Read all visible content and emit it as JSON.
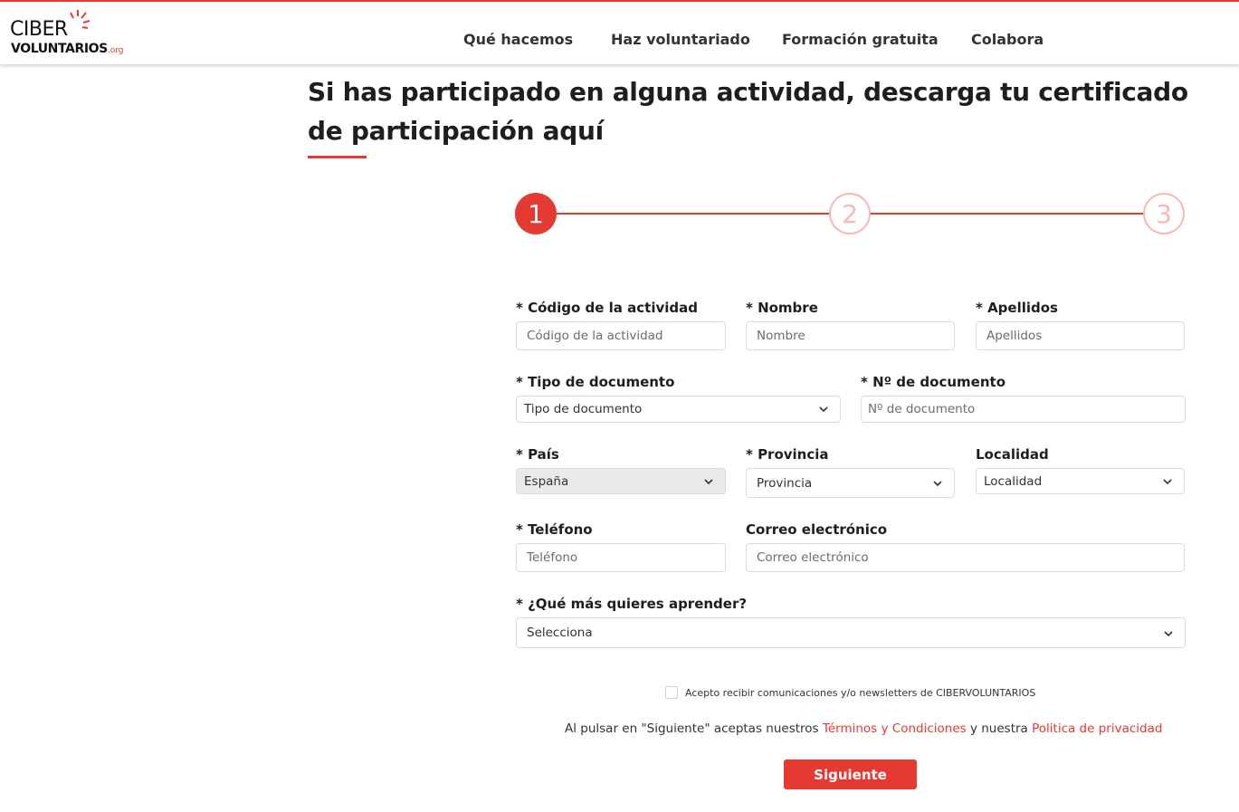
{
  "header": {
    "logo_top": "CIBER",
    "logo_bottom": "VOLUNTARIOS",
    "logo_org": ".org",
    "nav": [
      "Qué hacemos",
      "Haz voluntariado",
      "Formación gratuita",
      "Colabora"
    ]
  },
  "page": {
    "headline": "Si has participado en alguna actividad, descarga tu certificado de participación aquí"
  },
  "stepper": {
    "steps": [
      "1",
      "2",
      "3"
    ],
    "current_step": 1
  },
  "form": {
    "codigo": {
      "label": "* Código de la actividad",
      "placeholder": "Código de la actividad"
    },
    "nombre": {
      "label": "* Nombre",
      "placeholder": "Nombre"
    },
    "apellidos": {
      "label": "* Apellidos",
      "placeholder": "Apellidos"
    },
    "tipo_doc": {
      "label": "* Tipo de documento",
      "value": "Tipo de documento"
    },
    "num_doc": {
      "label": "* Nº de documento",
      "placeholder": "Nº de documento"
    },
    "pais": {
      "label": "* País",
      "value": "España"
    },
    "provincia": {
      "label": "* Provincia",
      "value": "Provincia"
    },
    "localidad": {
      "label": "Localidad",
      "value": "Localidad"
    },
    "telefono": {
      "label": "* Teléfono",
      "placeholder": "Teléfono"
    },
    "correo": {
      "label": "Correo electrónico",
      "placeholder": "Correo electrónico"
    },
    "aprender": {
      "label": "* ¿Qué más quieres aprender?",
      "value": "Selecciona"
    },
    "newsletter_label": "Acepto recibir comunicaciones y/o newsletters de CIBERVOLUNTARIOS",
    "terms_prefix": "Al pulsar en \"Siguiente\" aceptas nuestros ",
    "terms_link": "Términos y Condiciones",
    "terms_middle": " y nuestra ",
    "privacy_link": "Politica de privacidad",
    "submit_label": "Siguiente"
  },
  "colors": {
    "accent": "#e53a32",
    "step_inactive": "#f7b8b4"
  },
  "icons": {
    "dropdown": "chevron-down-icon",
    "logo_decoration": "sparkle-rays-icon"
  }
}
